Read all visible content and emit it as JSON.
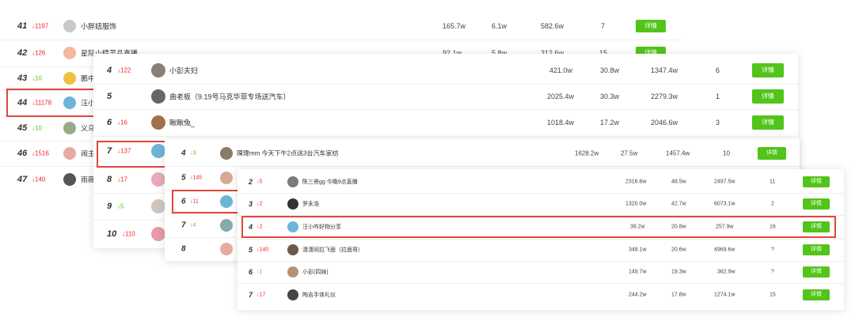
{
  "panel1": {
    "rows": [
      {
        "rank": "41",
        "dir": "down",
        "change": "1197",
        "name": "小胖妞服饰",
        "v1": "165.7w",
        "v2": "6.1w",
        "v3": "582.6w",
        "v4": "7",
        "btn": "详情"
      },
      {
        "rank": "42",
        "dir": "down",
        "change": "126",
        "name": "星际小精灵品直播",
        "v1": "92.1w",
        "v2": "5.8w",
        "v3": "312.6w",
        "v4": "15",
        "btn": "详情"
      },
      {
        "rank": "43",
        "dir": "up",
        "change": "10",
        "name": "鹏中"
      },
      {
        "rank": "44",
        "dir": "down",
        "change": "11178",
        "name": "汪小"
      },
      {
        "rank": "45",
        "dir": "up",
        "change": "10",
        "name": "义乌"
      },
      {
        "rank": "46",
        "dir": "down",
        "change": "1516",
        "name": "闹主"
      },
      {
        "rank": "47",
        "dir": "down",
        "change": "140",
        "name": "雨薇"
      }
    ]
  },
  "panel2": {
    "rows": [
      {
        "rank": "4",
        "dir": "down",
        "change": "122",
        "name": "小彭夫妇",
        "v1": "421.0w",
        "v2": "30.8w",
        "v3": "1347.4w",
        "v4": "6",
        "btn": "详情"
      },
      {
        "rank": "5",
        "dir": "",
        "change": "",
        "name": "曲老板（9.19号马克华菲专场送汽车）",
        "v1": "2025.4w",
        "v2": "30.3w",
        "v3": "2279.3w",
        "v4": "1",
        "btn": "详情"
      },
      {
        "rank": "6",
        "dir": "down",
        "change": "16",
        "name": "瞅瞅兔_",
        "v1": "1018.4w",
        "v2": "17.2w",
        "v3": "2046.6w",
        "v4": "3",
        "btn": "详情"
      },
      {
        "rank": "7",
        "dir": "down",
        "change": "137"
      },
      {
        "rank": "8",
        "dir": "down",
        "change": "17"
      },
      {
        "rank": "9",
        "dir": "up",
        "change": "5"
      },
      {
        "rank": "10",
        "dir": "down",
        "change": "110"
      }
    ]
  },
  "panel3": {
    "rows": [
      {
        "rank": "4",
        "dir": "up",
        "change": "3",
        "name": "陳瑋mm 今天下午2点送3台汽车家纺",
        "v1": "1628.2w",
        "v2": "27.5w",
        "v3": "1457.4w",
        "v4": "10",
        "btn": "详情"
      },
      {
        "rank": "5",
        "dir": "down",
        "change": "145"
      },
      {
        "rank": "6",
        "dir": "down",
        "change": "11"
      },
      {
        "rank": "7",
        "dir": "up",
        "change": "4"
      },
      {
        "rank": "8",
        "dir": "",
        "change": ""
      }
    ]
  },
  "panel4": {
    "rows": [
      {
        "rank": "2",
        "dir": "down",
        "change": "5",
        "name": "陈三爸gg 今晚9点直播",
        "v1": "2316.6w",
        "v2": "48.5w",
        "v3": "2497.5w",
        "v4": "11",
        "btn": "详情"
      },
      {
        "rank": "3",
        "dir": "down",
        "change": "2",
        "name": "罗永浩",
        "v1": "1320.0w",
        "v2": "42.7w",
        "v3": "6073.1w",
        "v4": "2",
        "btn": "详情"
      },
      {
        "rank": "4",
        "dir": "down",
        "change": "2",
        "name": "汪小咋好物分享",
        "v1": "39.2w",
        "v2": "20.8w",
        "v3": "257.9w",
        "v4": "16",
        "btn": "详情"
      },
      {
        "rank": "5",
        "dir": "down",
        "change": "140",
        "name": "潇潇同拉飞面（拉面哥）",
        "v1": "348.1w",
        "v2": "20.6w",
        "v3": "4969.6w",
        "v4": "?",
        "btn": "详情"
      },
      {
        "rank": "6",
        "dir": "up",
        "change": "1",
        "name": "小彭(四妹)",
        "v1": "149.7w",
        "v2": "19.3w",
        "v3": "362.9w",
        "v4": "?",
        "btn": "详情"
      },
      {
        "rank": "7",
        "dir": "down",
        "change": "17",
        "name": "陶吉手体礼仪",
        "v1": "244.2w",
        "v2": "17.8w",
        "v3": "1274.1w",
        "v4": "15",
        "btn": "详情"
      }
    ]
  },
  "colors": {
    "button": "#52c41a",
    "up": "#52c41a",
    "down": "#f5222d",
    "highlight": "#e0463b"
  }
}
